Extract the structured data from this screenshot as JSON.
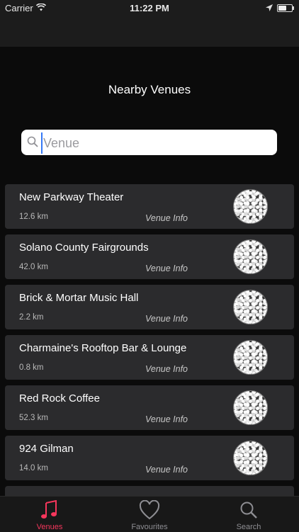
{
  "status_bar": {
    "carrier": "Carrier",
    "time": "11:22 PM"
  },
  "page": {
    "title": "Nearby Venues"
  },
  "search": {
    "placeholder": "Venue",
    "value": ""
  },
  "venues": [
    {
      "name": "New Parkway Theater",
      "distance": "12.6 km",
      "info_label": "Venue Info"
    },
    {
      "name": "Solano County Fairgrounds",
      "distance": "42.0 km",
      "info_label": "Venue Info"
    },
    {
      "name": "Brick & Mortar Music Hall",
      "distance": "2.2 km",
      "info_label": "Venue Info"
    },
    {
      "name": "Charmaine's Rooftop Bar & Lounge",
      "distance": "0.8 km",
      "info_label": "Venue Info"
    },
    {
      "name": "Red Rock Coffee",
      "distance": "52.3 km",
      "info_label": "Venue Info"
    },
    {
      "name": "924 Gilman",
      "distance": "14.0 km",
      "info_label": "Venue Info"
    }
  ],
  "tabs": [
    {
      "label": "Venues",
      "icon": "music-note-icon",
      "active": true
    },
    {
      "label": "Favourites",
      "icon": "heart-icon",
      "active": false
    },
    {
      "label": "Search",
      "icon": "search-icon",
      "active": false
    }
  ],
  "colors": {
    "accent": "#f5365c",
    "card": "#2b2b2d",
    "background": "#0b0b0b"
  }
}
